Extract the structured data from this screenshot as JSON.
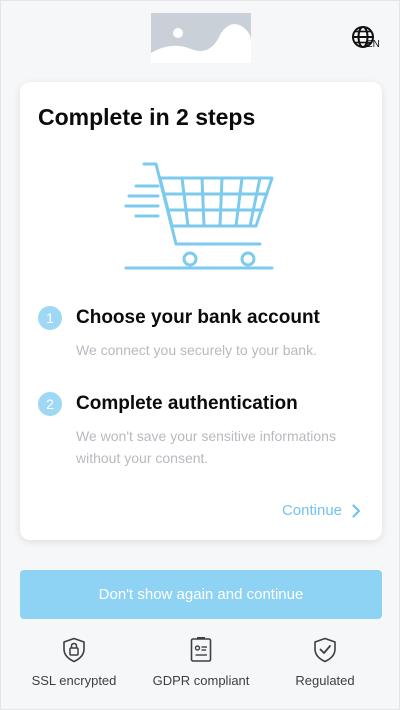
{
  "header": {
    "logo_icon": "image-placeholder-icon",
    "language_icon": "globe-icon",
    "language_code": "EN"
  },
  "card": {
    "title": "Complete in 2 steps",
    "illustration_icon": "shopping-cart-icon",
    "steps": [
      {
        "number": "1",
        "title": "Choose your bank account",
        "description": "We connect you securely to your bank."
      },
      {
        "number": "2",
        "title": "Complete authentication",
        "description": "We won't save your sensitive informations without your consent."
      }
    ],
    "continue_label": "Continue"
  },
  "primary_button": {
    "label": "Don't show again and continue"
  },
  "trust_badges": [
    {
      "icon": "lock-shield-icon",
      "label": "SSL encrypted"
    },
    {
      "icon": "document-check-icon",
      "label": "GDPR compliant"
    },
    {
      "icon": "check-shield-icon",
      "label": "Regulated"
    }
  ],
  "colors": {
    "accent": "#8fd3f4",
    "accent_text": "#6fc5ee",
    "muted_text": "#b6babf"
  }
}
